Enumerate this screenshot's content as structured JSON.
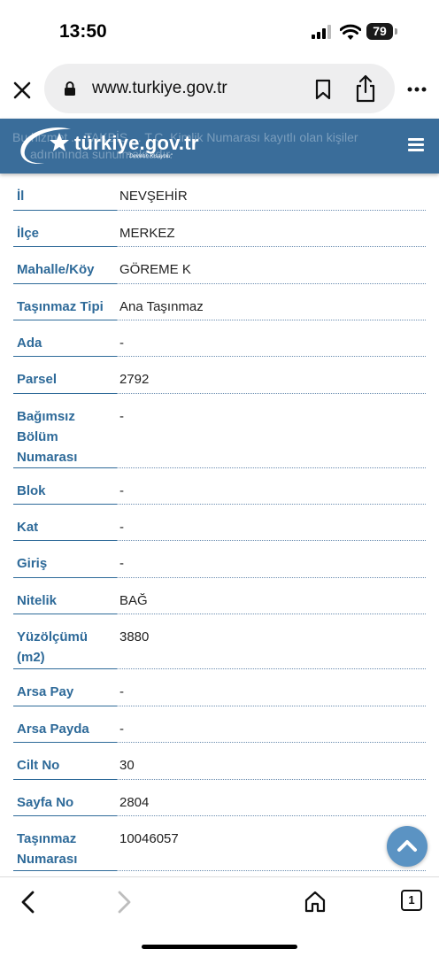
{
  "status_bar": {
    "time": "13:50",
    "battery": "79"
  },
  "browser": {
    "url": "www.turkiye.gov.tr"
  },
  "header": {
    "logo_text": "türkiye.gov.tr",
    "logo_tagline": "\"Devletin Kısayolu\"",
    "ghost_line1": "Bu hizmet ... TAKBİS ... T.C. Kimlik Numarası kayıtlı olan kişiler",
    "ghost_line2": "adınınında sunulmaktadır."
  },
  "rows": [
    {
      "label": "İl",
      "value": "NEVŞEHİR"
    },
    {
      "label": "İlçe",
      "value": "MERKEZ"
    },
    {
      "label": "Mahalle/Köy",
      "value": "GÖREME K"
    },
    {
      "label": "Taşınmaz Tipi",
      "value": "Ana Taşınmaz"
    },
    {
      "label": "Ada",
      "value": "-"
    },
    {
      "label": "Parsel",
      "value": "2792"
    },
    {
      "label": "Bağımsız Bölüm Numarası",
      "value": "-"
    },
    {
      "label": "Blok",
      "value": "-"
    },
    {
      "label": "Kat",
      "value": "-"
    },
    {
      "label": "Giriş",
      "value": "-"
    },
    {
      "label": "Nitelik",
      "value": "BAĞ"
    },
    {
      "label": "Yüzölçümü (m2)",
      "value": "3880"
    },
    {
      "label": "Arsa Pay",
      "value": "-"
    },
    {
      "label": "Arsa Payda",
      "value": "-"
    },
    {
      "label": "Cilt No",
      "value": "30"
    },
    {
      "label": "Sayfa No",
      "value": "2804"
    },
    {
      "label": "Taşınmaz Numarası",
      "value": "10046057"
    }
  ],
  "bottom_bar": {
    "tab_count": "1"
  },
  "colors": {
    "header_bg": "#3a6d9a",
    "label": "#2e6a99",
    "scroll_button": "#5b93c3"
  }
}
